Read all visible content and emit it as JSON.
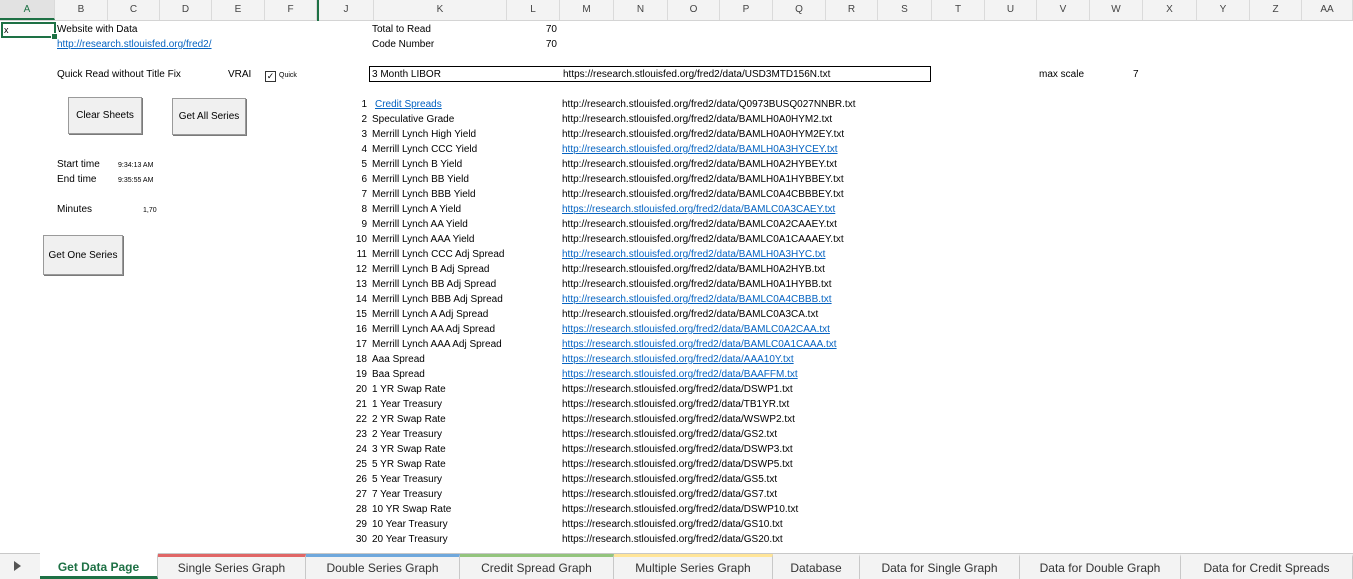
{
  "grid": {
    "columns": [
      "A",
      "B",
      "C",
      "D",
      "E",
      "F",
      "J",
      "K",
      "L",
      "M",
      "N",
      "O",
      "P",
      "Q",
      "R",
      "S",
      "T",
      "U",
      "V",
      "W",
      "X",
      "Y",
      "Z",
      "AA"
    ],
    "active_cell_value": "x"
  },
  "left_panel": {
    "website_label": "Website with Data",
    "website_url": "http://research.stlouisfed.org/fred2/",
    "quick_read_label": "Quick Read without Title Fix",
    "vrai": "VRAI",
    "quick_checkbox_label": "Quick",
    "quick_checked": "✓",
    "clear_sheets_button": "Clear Sheets",
    "get_all_series_button": "Get All Series",
    "start_time_label": "Start time",
    "start_time_value": "9:34:13 AM",
    "end_time_label": "End time",
    "end_time_value": "9:35:55 AM",
    "minutes_label": "Minutes",
    "minutes_value": "1,70",
    "get_one_series_button": "Get One Series"
  },
  "summary": {
    "total_to_read_label": "Total to Read",
    "total_to_read_value": "70",
    "code_number_label": "Code Number",
    "code_number_value": "70",
    "selected_series_name": "3 Month LIBOR",
    "selected_series_url": "https://research.stlouisfed.org/fred2/data/USD3MTD156N.txt",
    "max_scale_label": "max scale",
    "max_scale_value": "7"
  },
  "series": [
    {
      "n": "1",
      "name": "Credit Spreads",
      "url": "http://research.stlouisfed.org/fred2/data/Q0973BUSQ027NNBR.txt"
    },
    {
      "n": "2",
      "name": "Speculative Grade",
      "url": "http://research.stlouisfed.org/fred2/data/BAMLH0A0HYM2.txt"
    },
    {
      "n": "3",
      "name": "Merrill Lynch High Yield",
      "url": "http://research.stlouisfed.org/fred2/data/BAMLH0A0HYM2EY.txt"
    },
    {
      "n": "4",
      "name": "Merrill Lynch CCC Yield",
      "url": "http://research.stlouisfed.org/fred2/data/BAMLH0A3HYCEY.txt"
    },
    {
      "n": "5",
      "name": "Merrill Lynch B Yield",
      "url": "http://research.stlouisfed.org/fred2/data/BAMLH0A2HYBEY.txt"
    },
    {
      "n": "6",
      "name": "Merrill Lynch BB Yield",
      "url": "http://research.stlouisfed.org/fred2/data/BAMLH0A1HYBBEY.txt"
    },
    {
      "n": "7",
      "name": "Merrill Lynch BBB Yield",
      "url": "http://research.stlouisfed.org/fred2/data/BAMLC0A4CBBBEY.txt"
    },
    {
      "n": "8",
      "name": "Merrill Lynch A Yield",
      "url": "https://research.stlouisfed.org/fred2/data/BAMLC0A3CAEY.txt"
    },
    {
      "n": "9",
      "name": "Merrill Lynch AA Yield",
      "url": "http://research.stlouisfed.org/fred2/data/BAMLC0A2CAAEY.txt"
    },
    {
      "n": "10",
      "name": "Merrill Lynch AAA Yield",
      "url": "http://research.stlouisfed.org/fred2/data/BAMLC0A1CAAAEY.txt"
    },
    {
      "n": "11",
      "name": "Merrill Lynch CCC Adj Spread",
      "url": "http://research.stlouisfed.org/fred2/data/BAMLH0A3HYC.txt"
    },
    {
      "n": "12",
      "name": "Merrill Lynch B Adj Spread",
      "url": "http://research.stlouisfed.org/fred2/data/BAMLH0A2HYB.txt"
    },
    {
      "n": "13",
      "name": "Merrill Lynch BB Adj Spread",
      "url": "http://research.stlouisfed.org/fred2/data/BAMLH0A1HYBB.txt"
    },
    {
      "n": "14",
      "name": "Merrill Lynch BBB Adj Spread",
      "url": "http://research.stlouisfed.org/fred2/data/BAMLC0A4CBBB.txt"
    },
    {
      "n": "15",
      "name": "Merrill Lynch A Adj Spread",
      "url": "http://research.stlouisfed.org/fred2/data/BAMLC0A3CA.txt"
    },
    {
      "n": "16",
      "name": "Merrill Lynch AA Adj Spread",
      "url": "https://research.stlouisfed.org/fred2/data/BAMLC0A2CAA.txt"
    },
    {
      "n": "17",
      "name": "Merrill Lynch AAA Adj Spread",
      "url": "https://research.stlouisfed.org/fred2/data/BAMLC0A1CAAA.txt"
    },
    {
      "n": "18",
      "name": "Aaa Spread",
      "url": "https://research.stlouisfed.org/fred2/data/AAA10Y.txt"
    },
    {
      "n": "19",
      "name": "Baa Spread",
      "url": "https://research.stlouisfed.org/fred2/data/BAAFFM.txt"
    },
    {
      "n": "20",
      "name": "1 YR Swap Rate",
      "url": "https://research.stlouisfed.org/fred2/data/DSWP1.txt"
    },
    {
      "n": "21",
      "name": "1 Year Treasury",
      "url": "https://research.stlouisfed.org/fred2/data/TB1YR.txt"
    },
    {
      "n": "22",
      "name": "2 YR Swap Rate",
      "url": "https://research.stlouisfed.org/fred2/data/WSWP2.txt"
    },
    {
      "n": "23",
      "name": "2 Year Treasury",
      "url": "https://research.stlouisfed.org/fred2/data/GS2.txt"
    },
    {
      "n": "24",
      "name": "3 YR Swap Rate",
      "url": "https://research.stlouisfed.org/fred2/data/DSWP3.txt"
    },
    {
      "n": "25",
      "name": "5 YR Swap Rate",
      "url": "https://research.stlouisfed.org/fred2/data/DSWP5.txt"
    },
    {
      "n": "26",
      "name": "5 Year Treasury",
      "url": "https://research.stlouisfed.org/fred2/data/GS5.txt"
    },
    {
      "n": "27",
      "name": "7 Year Treasury",
      "url": "https://research.stlouisfed.org/fred2/data/GS7.txt"
    },
    {
      "n": "28",
      "name": "10 YR Swap Rate",
      "url": "https://research.stlouisfed.org/fred2/data/DSWP10.txt"
    },
    {
      "n": "29",
      "name": "10 Year Treasury",
      "url": "https://research.stlouisfed.org/fred2/data/GS10.txt"
    },
    {
      "n": "30",
      "name": "20 Year Treasury",
      "url": "https://research.stlouisfed.org/fred2/data/GS20.txt"
    }
  ],
  "tabs": [
    {
      "label": "Get Data Page",
      "accent": "#1e7145"
    },
    {
      "label": "Single Series Graph",
      "accent": "#e06666"
    },
    {
      "label": "Double Series Graph",
      "accent": "#6fa8dc"
    },
    {
      "label": "Credit Spread Graph",
      "accent": "#93c47d"
    },
    {
      "label": "Multiple Series Graph",
      "accent": "#ffe599"
    },
    {
      "label": "Database",
      "accent": ""
    },
    {
      "label": "Data for Single Graph",
      "accent": ""
    },
    {
      "label": "Data for Double Graph",
      "accent": ""
    },
    {
      "label": "Data for Credit Spreads",
      "accent": ""
    }
  ],
  "colors": {
    "excel_green": "#1e7145",
    "link_blue": "#0563c1"
  }
}
